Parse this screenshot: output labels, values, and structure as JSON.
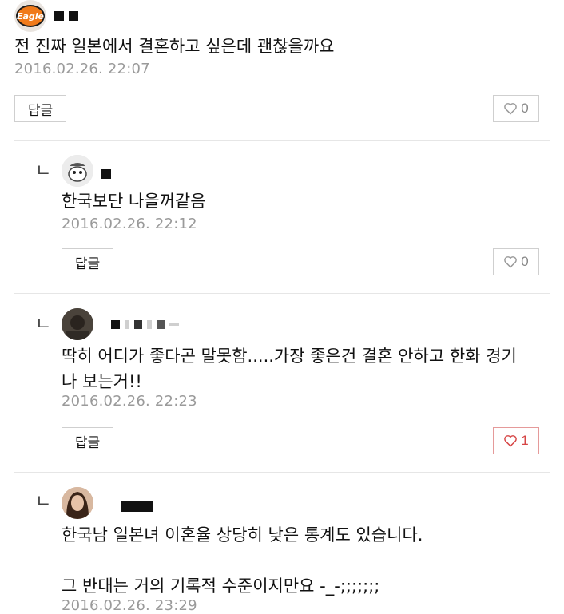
{
  "comments": [
    {
      "text": "전 진짜 일본에서 결혼하고 싶은데 괜찮을까요",
      "date": "2016.02.26. 22:07",
      "reply_label": "답글",
      "likes": "0",
      "liked": false,
      "avatar_text": "Eagle"
    },
    {
      "text": "한국보단 나을꺼같음",
      "date": "2016.02.26. 22:12",
      "reply_label": "답글",
      "likes": "0",
      "liked": false
    },
    {
      "text": "딱히 어디가 좋다곤 말못함.....가장 좋은건 결혼 안하고 한화 경기\n나 보는거!!",
      "date": "2016.02.26. 22:23",
      "reply_label": "답글",
      "likes": "1",
      "liked": true
    },
    {
      "text": "한국남 일본녀 이혼율 상당히 낮은 통계도 있습니다.\n\n그 반대는 거의 기록적 수준이지만요 -_-;;;;;;;",
      "date": "2016.02.26. 23:29"
    }
  ],
  "reply_arrow": "ㄴ",
  "colors": {
    "liked": "#d64545",
    "meta": "#9a9a9a",
    "border": "#cfcfcf"
  }
}
